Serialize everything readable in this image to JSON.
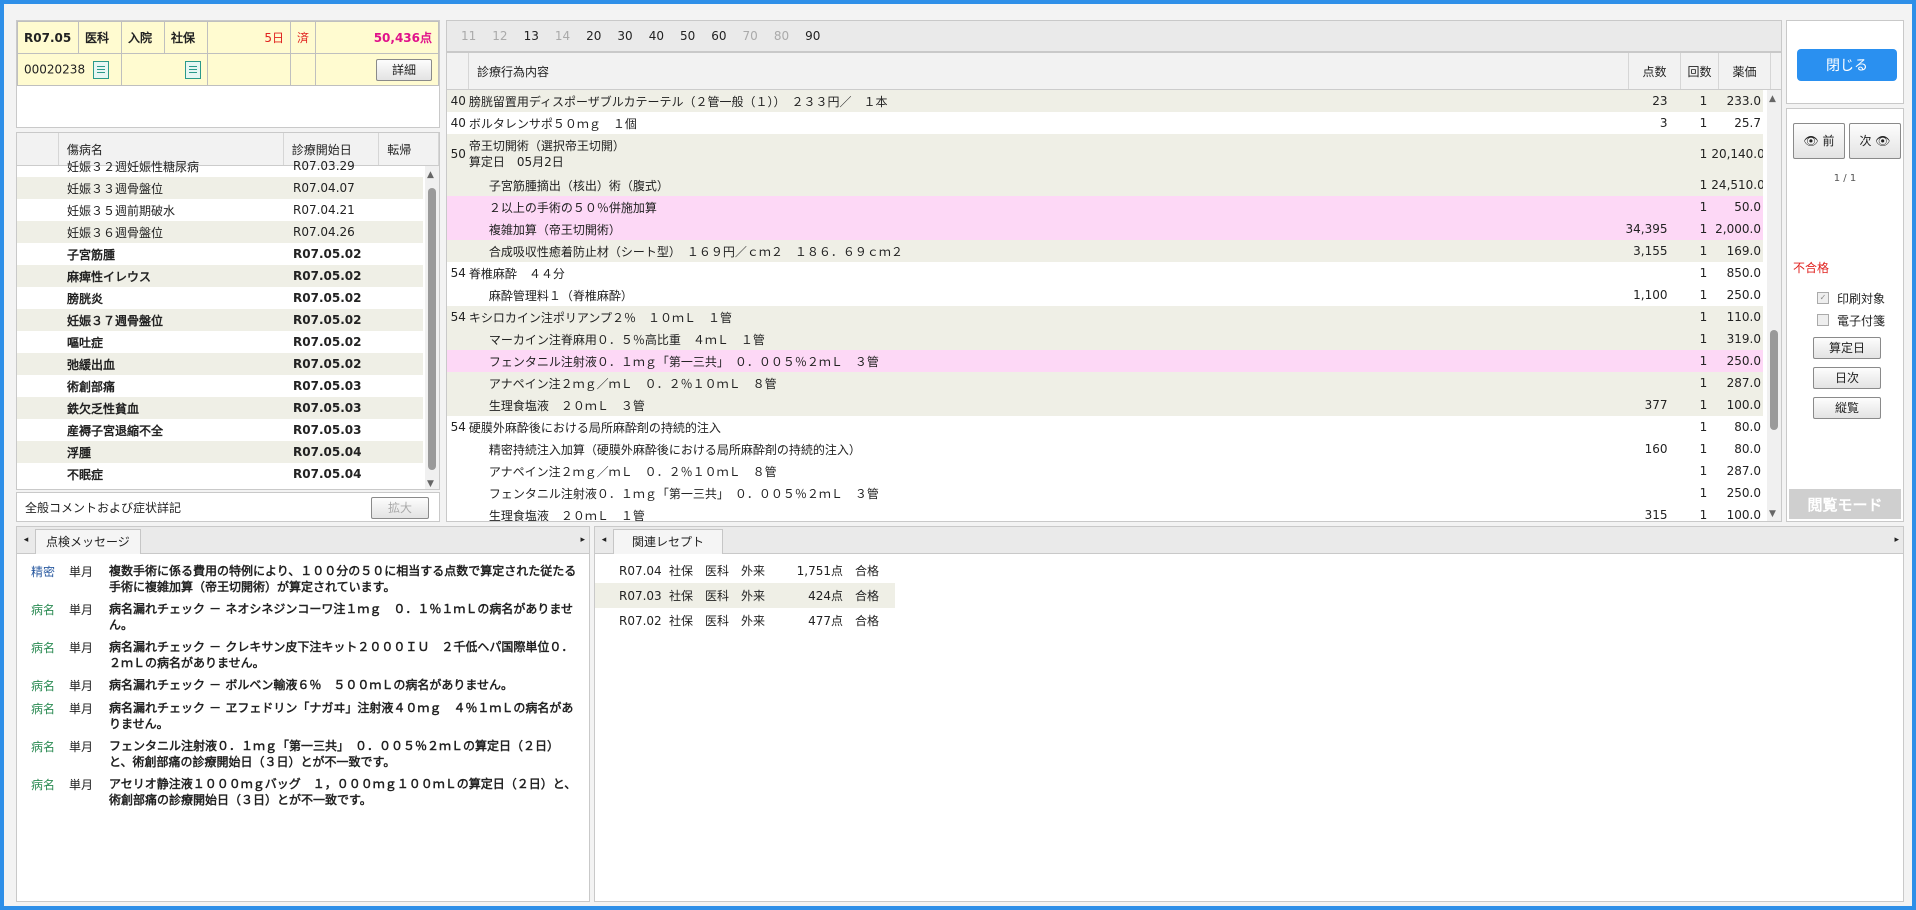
{
  "header": {
    "era_date": "R07.05",
    "dept": "医科",
    "type": "入院",
    "insurance": "社保",
    "days": "5日",
    "done": "済",
    "points": "50,436点",
    "patient_id": "00020238",
    "detail_label": "詳細"
  },
  "diseases": {
    "columns": [
      "傷病名",
      "診療開始日",
      "転帰"
    ],
    "rows": [
      {
        "name": "妊娠３２週妊娠性糖尿病",
        "date": "R07.03.29",
        "bold": false
      },
      {
        "name": "妊娠３３週骨盤位",
        "date": "R07.04.07",
        "bold": false
      },
      {
        "name": "妊娠３５週前期破水",
        "date": "R07.04.21",
        "bold": false
      },
      {
        "name": "妊娠３６週骨盤位",
        "date": "R07.04.26",
        "bold": false
      },
      {
        "name": "子宮筋腫",
        "date": "R07.05.02",
        "bold": true
      },
      {
        "name": "麻痺性イレウス",
        "date": "R07.05.02",
        "bold": true
      },
      {
        "name": "膀胱炎",
        "date": "R07.05.02",
        "bold": true
      },
      {
        "name": "妊娠３７週骨盤位",
        "date": "R07.05.02",
        "bold": true
      },
      {
        "name": "嘔吐症",
        "date": "R07.05.02",
        "bold": true
      },
      {
        "name": "弛緩出血",
        "date": "R07.05.02",
        "bold": true
      },
      {
        "name": "術創部痛",
        "date": "R07.05.03",
        "bold": true
      },
      {
        "name": "鉄欠乏性貧血",
        "date": "R07.05.03",
        "bold": true
      },
      {
        "name": "産褥子宮退縮不全",
        "date": "R07.05.03",
        "bold": true
      },
      {
        "name": "浮腫",
        "date": "R07.05.04",
        "bold": true
      },
      {
        "name": "不眠症",
        "date": "R07.05.04",
        "bold": true
      }
    ]
  },
  "comment": {
    "label": "全般コメントおよび症状詳記",
    "expand_label": "拡大"
  },
  "category_tabs": [
    {
      "label": "11",
      "enabled": false
    },
    {
      "label": "12",
      "enabled": false
    },
    {
      "label": "13",
      "enabled": true
    },
    {
      "label": "14",
      "enabled": false
    },
    {
      "label": "20",
      "enabled": true
    },
    {
      "label": "30",
      "enabled": true
    },
    {
      "label": "40",
      "enabled": true
    },
    {
      "label": "50",
      "enabled": true
    },
    {
      "label": "60",
      "enabled": true
    },
    {
      "label": "70",
      "enabled": false
    },
    {
      "label": "80",
      "enabled": false
    },
    {
      "label": "90",
      "enabled": true
    }
  ],
  "orders": {
    "columns": {
      "content": "診療行為内容",
      "points": "点数",
      "times": "回数",
      "price": "薬価"
    },
    "rows": [
      {
        "code": "40",
        "text": "膀胱留置用ディスポーザブルカテーテル（２管一般（１））　２３３円／　１本",
        "points": "23",
        "times": "1",
        "price": "233.0",
        "bg": "alt"
      },
      {
        "code": "40",
        "text": "ボルタレンサポ５０ｍｇ　１個",
        "points": "3",
        "times": "1",
        "price": "25.7",
        "bg": ""
      },
      {
        "code": "50",
        "text": "帝王切開術（選択帝王切開）",
        "text2": "算定日　05月2日",
        "points": "",
        "times": "1",
        "price": "20,140.0",
        "bg": "alt",
        "tall": true
      },
      {
        "code": "",
        "text": "子宮筋腫摘出（核出）術（腹式）",
        "points": "",
        "times": "1",
        "price": "24,510.0",
        "bg": "alt"
      },
      {
        "code": "",
        "text": "２以上の手術の５０％併施加算",
        "points": "",
        "times": "1",
        "price": "50.0",
        "bg": "pk"
      },
      {
        "code": "",
        "text": "複雑加算（帝王切開術）",
        "points": "34,395",
        "times": "1",
        "price": "2,000.0",
        "bg": "pk"
      },
      {
        "code": "",
        "text": "合成吸収性癒着防止材（シート型）　１６９円／ｃｍ２　１８６．６９ｃｍ２",
        "points": "3,155",
        "times": "1",
        "price": "169.0",
        "bg": "alt"
      },
      {
        "code": "54",
        "text": "脊椎麻酔　４４分",
        "points": "",
        "times": "1",
        "price": "850.0",
        "bg": ""
      },
      {
        "code": "",
        "text": "麻酔管理料１（脊椎麻酔）",
        "points": "1,100",
        "times": "1",
        "price": "250.0",
        "bg": ""
      },
      {
        "code": "54",
        "text": "キシロカイン注ポリアンプ２％　１０ｍＬ　１管",
        "points": "",
        "times": "1",
        "price": "110.0",
        "bg": "alt"
      },
      {
        "code": "",
        "text": "マーカイン注脊麻用０．５％高比重　４ｍＬ　１管",
        "points": "",
        "times": "1",
        "price": "319.0",
        "bg": "alt"
      },
      {
        "code": "",
        "text": "フェンタニル注射液０．１ｍｇ「第一三共」　０．００５％２ｍＬ　３管",
        "points": "",
        "times": "1",
        "price": "250.0",
        "bg": "pk"
      },
      {
        "code": "",
        "text": "アナペイン注２ｍｇ／ｍＬ　０．２％１０ｍＬ　８管",
        "points": "",
        "times": "1",
        "price": "287.0",
        "bg": "alt"
      },
      {
        "code": "",
        "text": "生理食塩液　２０ｍＬ　３管",
        "points": "377",
        "times": "1",
        "price": "100.0",
        "bg": "alt"
      },
      {
        "code": "54",
        "text": "硬膜外麻酔後における局所麻酔剤の持続的注入",
        "points": "",
        "times": "1",
        "price": "80.0",
        "bg": ""
      },
      {
        "code": "",
        "text": "精密持続注入加算（硬膜外麻酔後における局所麻酔剤の持続的注入）",
        "points": "160",
        "times": "1",
        "price": "80.0",
        "bg": ""
      },
      {
        "code": "",
        "text": "アナペイン注２ｍｇ／ｍＬ　０．２％１０ｍＬ　８管",
        "points": "",
        "times": "1",
        "price": "287.0",
        "bg": ""
      },
      {
        "code": "",
        "text": "フェンタニル注射液０．１ｍｇ「第一三共」　０．００５％２ｍＬ　３管",
        "points": "",
        "times": "1",
        "price": "250.0",
        "bg": ""
      },
      {
        "code": "",
        "text": "生理食塩液　２０ｍＬ　１管",
        "points": "315",
        "times": "1",
        "price": "100.0",
        "bg": ""
      }
    ]
  },
  "side": {
    "close_label": "閉じる",
    "prev_label": "前",
    "next_label": "次",
    "page": "1 / 1",
    "status": "不合格",
    "print_label": "印刷対象",
    "electronic_label": "電子付箋",
    "calc_date_label": "算定日",
    "daily_label": "日次",
    "vertical_label": "縦覧",
    "view_mode_label": "閲覧モード"
  },
  "check_messages": {
    "tab_label": "点検メッセージ",
    "items": [
      {
        "kind": "精密",
        "period": "単月",
        "text": "複数手術に係る費用の特例により、１００分の５０に相当する点数で算定された従たる手術に複雑加算（帝王切開術）が算定されています。",
        "blue": true
      },
      {
        "kind": "病名",
        "period": "単月",
        "text": "病名漏れチェック － ネオシネジンコーワ注１ｍｇ　０．１％１ｍＬの病名がありません。",
        "blue": false
      },
      {
        "kind": "病名",
        "period": "単月",
        "text": "病名漏れチェック － クレキサン皮下注キット２０００ＩＵ　２千低ヘパ国際単位０．２ｍＬの病名がありません。",
        "blue": false
      },
      {
        "kind": "病名",
        "period": "単月",
        "text": "病名漏れチェック － ボルベン輸液６％　５００ｍＬの病名がありません。",
        "blue": false
      },
      {
        "kind": "病名",
        "period": "単月",
        "text": "病名漏れチェック － ヱフェドリン「ナガヰ」注射液４０ｍｇ　４％１ｍＬの病名がありません。",
        "blue": false
      },
      {
        "kind": "病名",
        "period": "単月",
        "text": "フェンタニル注射液０．１ｍｇ「第一三共」　０．００５％２ｍＬの算定日（２日）と、術創部痛の診療開始日（３日）とが不一致です。",
        "blue": false
      },
      {
        "kind": "病名",
        "period": "単月",
        "text": "アセリオ静注液１０００ｍｇバッグ　１，０００ｍｇ１００ｍＬの算定日（２日）と、術創部痛の診療開始日（３日）とが不一致です。",
        "blue": false
      }
    ]
  },
  "related": {
    "tab_label": "関連レセプト",
    "rows": [
      {
        "date": "R07.04",
        "ins": "社保",
        "dept": "医科",
        "type": "外来",
        "points": "1,751点",
        "result": "合格"
      },
      {
        "date": "R07.03",
        "ins": "社保",
        "dept": "医科",
        "type": "外来",
        "points": "424点",
        "result": "合格"
      },
      {
        "date": "R07.02",
        "ins": "社保",
        "dept": "医科",
        "type": "外来",
        "points": "477点",
        "result": "合格"
      }
    ]
  }
}
